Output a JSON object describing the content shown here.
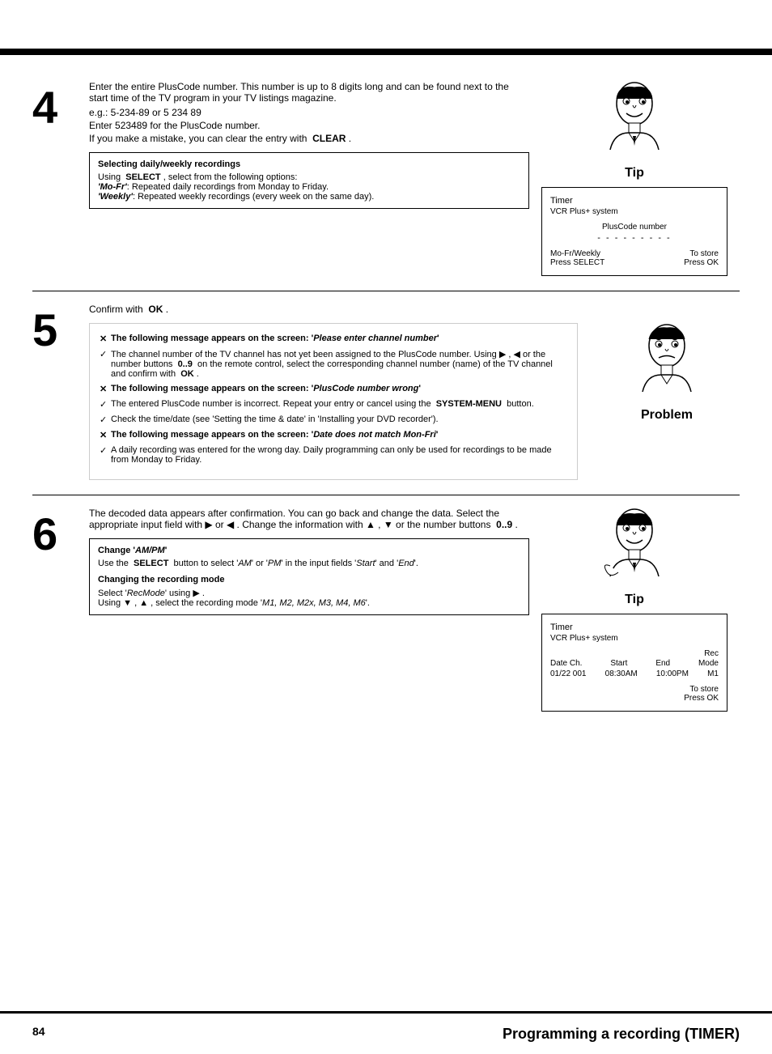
{
  "topBar": {},
  "bottomBar": {},
  "pageNumber": "84",
  "pageTitle": "Programming a recording (TIMER)",
  "step4": {
    "number": "4",
    "paragraphs": [
      "Enter the entire PlusCode number. This number is up to 8 digits long and can be found next to the start time of the TV program in your TV listings magazine.",
      "e.g.: 5-234-89 or 5 234 89",
      "Enter 523489 for the PlusCode number.",
      "If you make a mistake, you can clear the entry with  CLEAR ."
    ],
    "tipBox": {
      "title": "Selecting daily/weekly recordings",
      "intro": "Using  SELECT , select from the following options:",
      "options": [
        "'Mo-Fr': Repeated daily recordings from Monday to Friday.",
        "'Weekly': Repeated weekly recordings (every week on the same day)."
      ]
    },
    "characterLabel": "Tip",
    "timerDisplay": {
      "line1": "Timer",
      "line2": "VCR Plus+ system",
      "fieldLabel": "PlusCode number",
      "dashes": "- - - - - - - - -",
      "footerLeft1": "Mo-Fr/Weekly",
      "footerLeft2": "Press SELECT",
      "footerRight1": "To store",
      "footerRight2": "Press OK"
    }
  },
  "step5": {
    "number": "5",
    "intro": "Confirm with  OK .",
    "problemBox": {
      "items": [
        {
          "type": "cross",
          "header": "The following message appears on the screen: 'Please enter channel number'",
          "body": "The channel number of the TV channel has not yet been assigned to the PlusCode number. Using ▶ ,  ◀ or the number buttons  0..9 on the remote control, select the corresponding channel number (name) of the TV channel and confirm with  OK ."
        },
        {
          "type": "cross",
          "header": "The following message appears on the screen: 'PlusCode number wrong'",
          "body": "The entered PlusCode number is incorrect. Repeat your entry or cancel using the  SYSTEM-MENU button."
        },
        {
          "type": "check",
          "header": "",
          "body": "Check the time/date (see 'Setting the time & date' in 'Installing your DVD recorder')."
        },
        {
          "type": "cross",
          "header": "The following message appears on the screen: 'Date does not match Mon-Fri'",
          "body": "A daily recording was entered for the wrong day. Daily programming can only be used for recordings to be made from Monday to Friday."
        }
      ],
      "characterLabel": "Problem"
    }
  },
  "step6": {
    "number": "6",
    "paragraphs": [
      "The decoded data appears after confirmation. You can go back and change the data. Select the appropriate input field with ▶ or ◀ . Change the information with ▲ ,  ▼ or the number buttons  0..9 ."
    ],
    "tipBox": {
      "sections": [
        {
          "title": "Change 'AM/PM'",
          "body": "Use the  SELECT button to select 'AM' or 'PM' in the input fields 'Start' and 'End'."
        },
        {
          "title": "Changing the recording mode",
          "body": "Select 'RecMode' using ▶ .",
          "body2": "Using ▼ , ▲ , select the recording mode 'M1, M2, M2x, M3, M4, M6'."
        }
      ]
    },
    "characterLabel": "Tip",
    "timerDisplay": {
      "line1": "Timer",
      "line2": "VCR Plus+ system",
      "headers": [
        "Date",
        "Ch.",
        "Start",
        "End",
        "Rec Mode"
      ],
      "values": [
        "01/22",
        "001",
        "08:30AM",
        "10:00PM",
        "M1"
      ],
      "footerLeft1": "",
      "footerLeft2": "",
      "footerRight1": "To store",
      "footerRight2": "Press OK"
    }
  }
}
